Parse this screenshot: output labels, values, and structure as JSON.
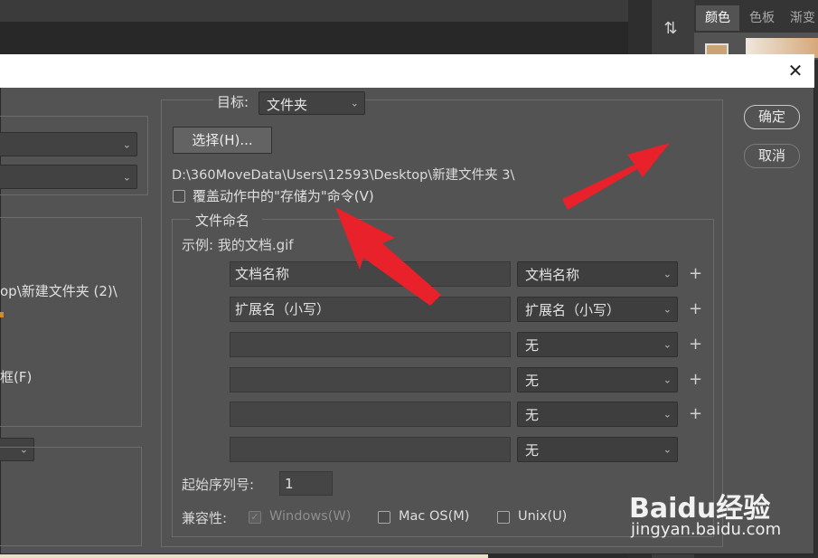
{
  "app": {
    "panel_tabs": [
      "颜色",
      "色板",
      "渐变"
    ],
    "history_icon": "history-brush-icon"
  },
  "dialog": {
    "close_glyph": "✕",
    "ok_label": "确定",
    "cancel_label": "取消",
    "left_partial": {
      "path_text": "op\\新建文件夹 (2)\\",
      "frame_label": "框(F)"
    },
    "destination": {
      "label": "目标:",
      "value": "文件夹",
      "choose_label": "选择(H)...",
      "path": "D:\\360MoveData\\Users\\12593\\Desktop\\新建文件夹 3\\",
      "override_label": "覆盖动作中的\"存储为\"命令(V)",
      "override_checked": false
    },
    "file_naming": {
      "title": "文件命名",
      "example": "示例: 我的文档.gif",
      "rows": [
        {
          "text": "文档名称",
          "select": "文档名称",
          "plus": "+"
        },
        {
          "text": "扩展名（小写）",
          "select": "扩展名（小写）",
          "plus": "+"
        },
        {
          "text": "",
          "select": "无",
          "plus": "+"
        },
        {
          "text": "",
          "select": "无",
          "plus": "+"
        },
        {
          "text": "",
          "select": "无",
          "plus": "+"
        },
        {
          "text": "",
          "select": "无",
          "plus": ""
        }
      ],
      "serial_label": "起始序列号:",
      "serial_value": "1",
      "compat_label": "兼容性:",
      "compat": {
        "windows": {
          "label": "Windows(W)",
          "checked": true,
          "disabled": true
        },
        "mac": {
          "label": "Mac OS(M)",
          "checked": false
        },
        "unix": {
          "label": "Unix(U)",
          "checked": false
        }
      }
    }
  },
  "watermark": {
    "brand": "Baidu经验",
    "url": "jingyan.baidu.com"
  },
  "colors": {
    "dialog_bg": "#535353",
    "arrow_red": "#e8212a"
  }
}
